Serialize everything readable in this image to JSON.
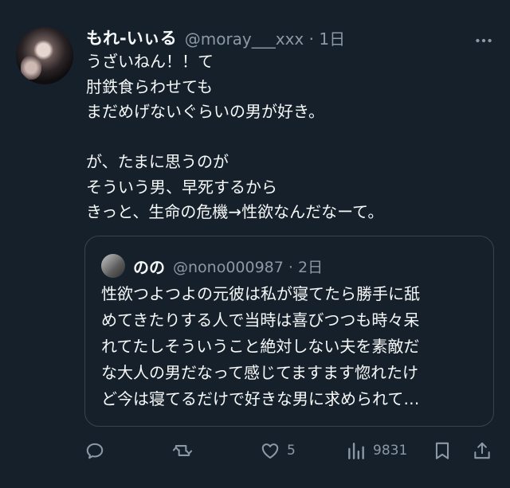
{
  "author": {
    "name": "もれ-いぃる",
    "handle": "@moray___xxx",
    "time": "1日"
  },
  "body": [
    "うざいねん！！て",
    "肘鉄食らわせても",
    "まだめげないぐらいの男が好き。",
    "",
    "が、たまに思うのが",
    "そういう男、早死するから",
    "きっと、生命の危機→性欲なんだなーて。"
  ],
  "quote": {
    "name": "のの",
    "handle": "@nono000987",
    "time": "2日",
    "text": [
      "性欲つよつよの元彼は私が寝てたら勝手に舐",
      "めてきたりする人で当時は喜びつつも時々呆",
      "れてたしそういうこと絶対しない夫を素敵だ",
      "な大人の男だなって感じてますます惚れたけ",
      "ど今は寝てるだけで好きな男に求められて…"
    ]
  },
  "actions": {
    "likes": "5",
    "views": "9831"
  },
  "icons": [
    "more-icon",
    "reply-icon",
    "retweet-icon",
    "like-icon",
    "views-icon",
    "bookmark-icon",
    "share-icon"
  ]
}
